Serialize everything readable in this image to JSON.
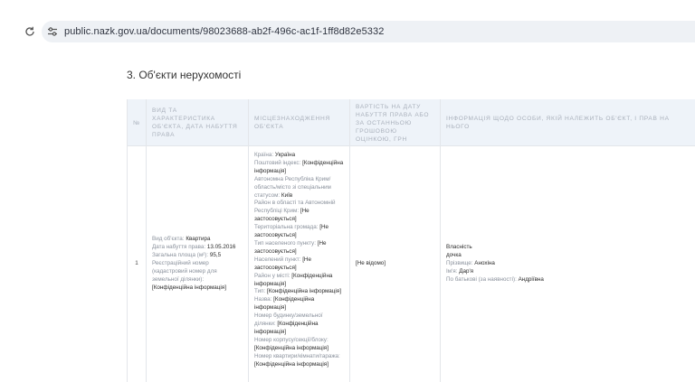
{
  "browser": {
    "url": "public.nazk.gov.ua/documents/98023688-ab2f-496c-ac1f-1ff8d82e5332"
  },
  "section": {
    "title": "3. Об'єкти нерухомості"
  },
  "table": {
    "headers": [
      "№",
      "Вид та характеристика об'єкта, дата набуття права",
      "Місцезнаходження об'єкта",
      "Вартість на дату набуття права або за останньою грошовою оцінкою, грн",
      "Інформація щодо особи, якій належить об'єкт, і прав на нього"
    ],
    "row": {
      "num": "1",
      "object": {
        "type_label": "Вид об'єкта:",
        "type_value": "Квартира",
        "date_label": "Дата набуття права:",
        "date_value": "13.05.2016",
        "area_label": "Загальна площа (м²):",
        "area_value": "95,5",
        "cadastre_label": "Реєстраційний номер (кадастровий номер для земельної ділянки):",
        "cadastre_value": "[Конфіденційна інформація]"
      },
      "location": [
        {
          "label": "Країна:",
          "value": "Україна"
        },
        {
          "label": "Поштовий індекс:",
          "value": "[Конфіденційна інформація]"
        },
        {
          "label": "Автономна Республіка Крим/область/місто зі спеціальним статусом:",
          "value": "Київ"
        },
        {
          "label": "Район в області та Автономній Республіці Крим:",
          "value": "[Не застосовується]"
        },
        {
          "label": "Територіальна громада:",
          "value": "[Не застосовується]"
        },
        {
          "label": "Тип населеного пункту:",
          "value": "[Не застосовується]"
        },
        {
          "label": "Населений пункт:",
          "value": "[Не застосовується]"
        },
        {
          "label": "Район у місті:",
          "value": "[Конфіденційна інформація]"
        },
        {
          "label": "Тип:",
          "value": "[Конфіденційна інформація]"
        },
        {
          "label": "Назва:",
          "value": "[Конфіденційна інформація]"
        },
        {
          "label": "Номер будинку/земельної ділянки:",
          "value": "[Конфіденційна інформація]"
        },
        {
          "label": "Номер корпусу/секції/блоку:",
          "value": "[Конфіденційна інформація]"
        },
        {
          "label": "Номер квартири/кімнати/гаража:",
          "value": "[Конфіденційна інформація]"
        }
      ],
      "value": "[Не відомо]",
      "owner": {
        "right": "Власність",
        "relation": "дочка",
        "surname_label": "Прізвище:",
        "surname_value": "Анохіна",
        "name_label": "Ім'я:",
        "name_value": "Дар'я",
        "patronymic_label": "По батькові (за наявності):",
        "patronymic_value": "Андріївна"
      }
    }
  }
}
